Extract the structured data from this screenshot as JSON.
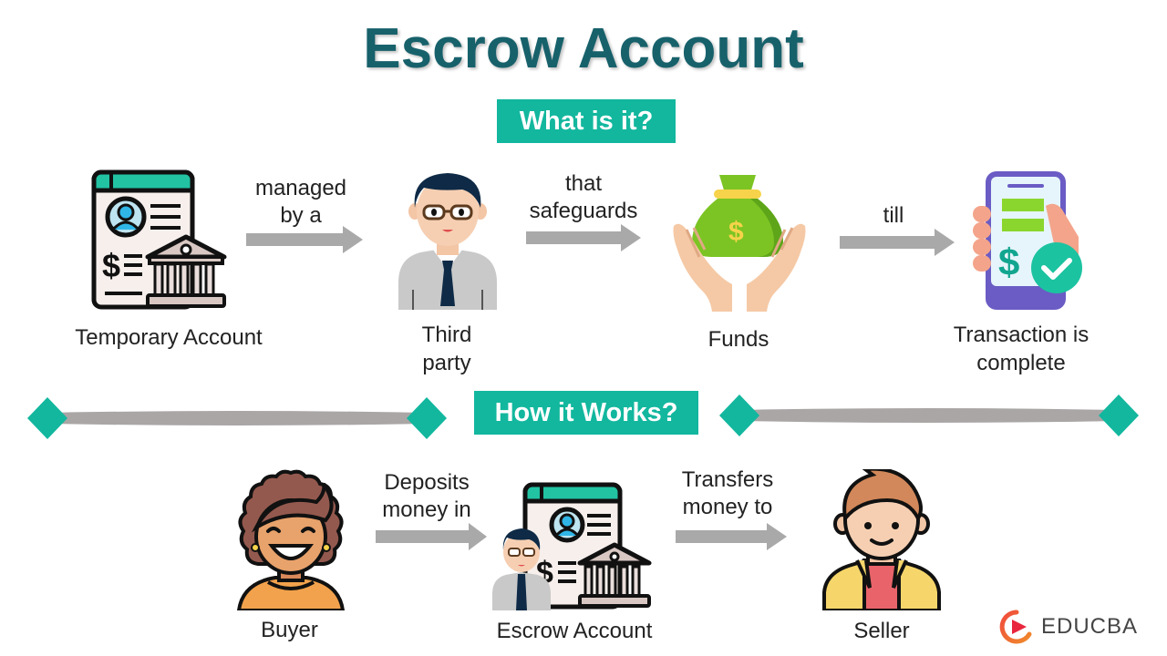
{
  "title": "Escrow Account",
  "sections": {
    "what": {
      "label": "What is it?"
    },
    "how": {
      "label": "How it Works?"
    }
  },
  "what_flow": {
    "steps": [
      {
        "label": "Temporary Account",
        "icon": "account-document-bank-icon"
      },
      {
        "label": "Third party",
        "icon": "businessman-icon"
      },
      {
        "label": "Funds",
        "icon": "money-bag-hands-icon"
      },
      {
        "label": "Transaction is complete",
        "icon": "phone-payment-check-icon"
      }
    ],
    "connectors": [
      {
        "line1": "managed",
        "line2": "by a"
      },
      {
        "line1": "that",
        "line2": "safeguards"
      },
      {
        "line1": "",
        "line2": "till"
      }
    ],
    "step_lines": {
      "third_party": [
        "Third",
        "party"
      ],
      "transaction": [
        "Transaction is",
        "complete"
      ]
    }
  },
  "how_flow": {
    "steps": [
      {
        "label": "Buyer",
        "icon": "buyer-woman-icon"
      },
      {
        "label": "Escrow Account",
        "icon": "escrow-agent-bank-icon"
      },
      {
        "label": "Seller",
        "icon": "seller-man-icon"
      }
    ],
    "connectors": [
      {
        "line1": "Deposits",
        "line2": "money in"
      },
      {
        "line1": "Transfers",
        "line2": "money to"
      }
    ]
  },
  "branding": {
    "logo_text": "EDUCBA"
  },
  "colors": {
    "title": "#17616b",
    "accent": "#12b79e",
    "arrow": "#a9a9a9",
    "divider": "#aaa6a6"
  }
}
